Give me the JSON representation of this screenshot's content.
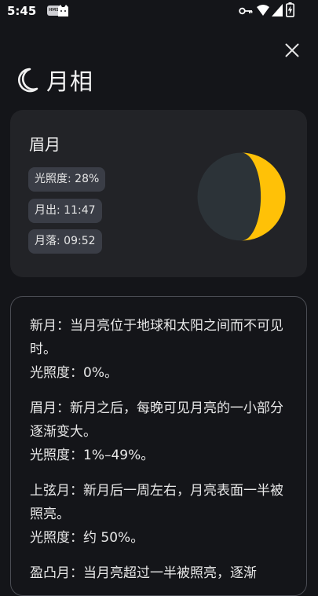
{
  "status_bar": {
    "time": "5:45",
    "badge_text": "HMS",
    "icons": [
      "hms-badge-icon",
      "cat-icon",
      "key-icon",
      "wifi-icon",
      "signal-icon",
      "battery-charging-icon"
    ]
  },
  "header": {
    "title": "月相",
    "close_icon": "close-icon",
    "title_icon": "crescent-moon-icon"
  },
  "phase_card": {
    "phase_name": "眉月",
    "illumination": "光照度: 28%",
    "moonrise": "月出: 11:47",
    "moonset": "月落: 09:52",
    "illumination_fraction": 0.28,
    "colors": {
      "lit": "#FFC107",
      "dark": "#2C3338"
    }
  },
  "descriptions": [
    {
      "text": "新月：当月亮位于地球和太阳之间而不可见时。",
      "illumination": "光照度：0%。"
    },
    {
      "text": "眉月：新月之后，每晚可见月亮的一小部分逐渐变大。",
      "illumination": "光照度：1%–49%。"
    },
    {
      "text": "上弦月：新月后一周左右，月亮表面一半被照亮。",
      "illumination": "光照度：约 50%。"
    },
    {
      "text": "盈凸月：当月亮超过一半被照亮，逐渐",
      "illumination": ""
    }
  ]
}
